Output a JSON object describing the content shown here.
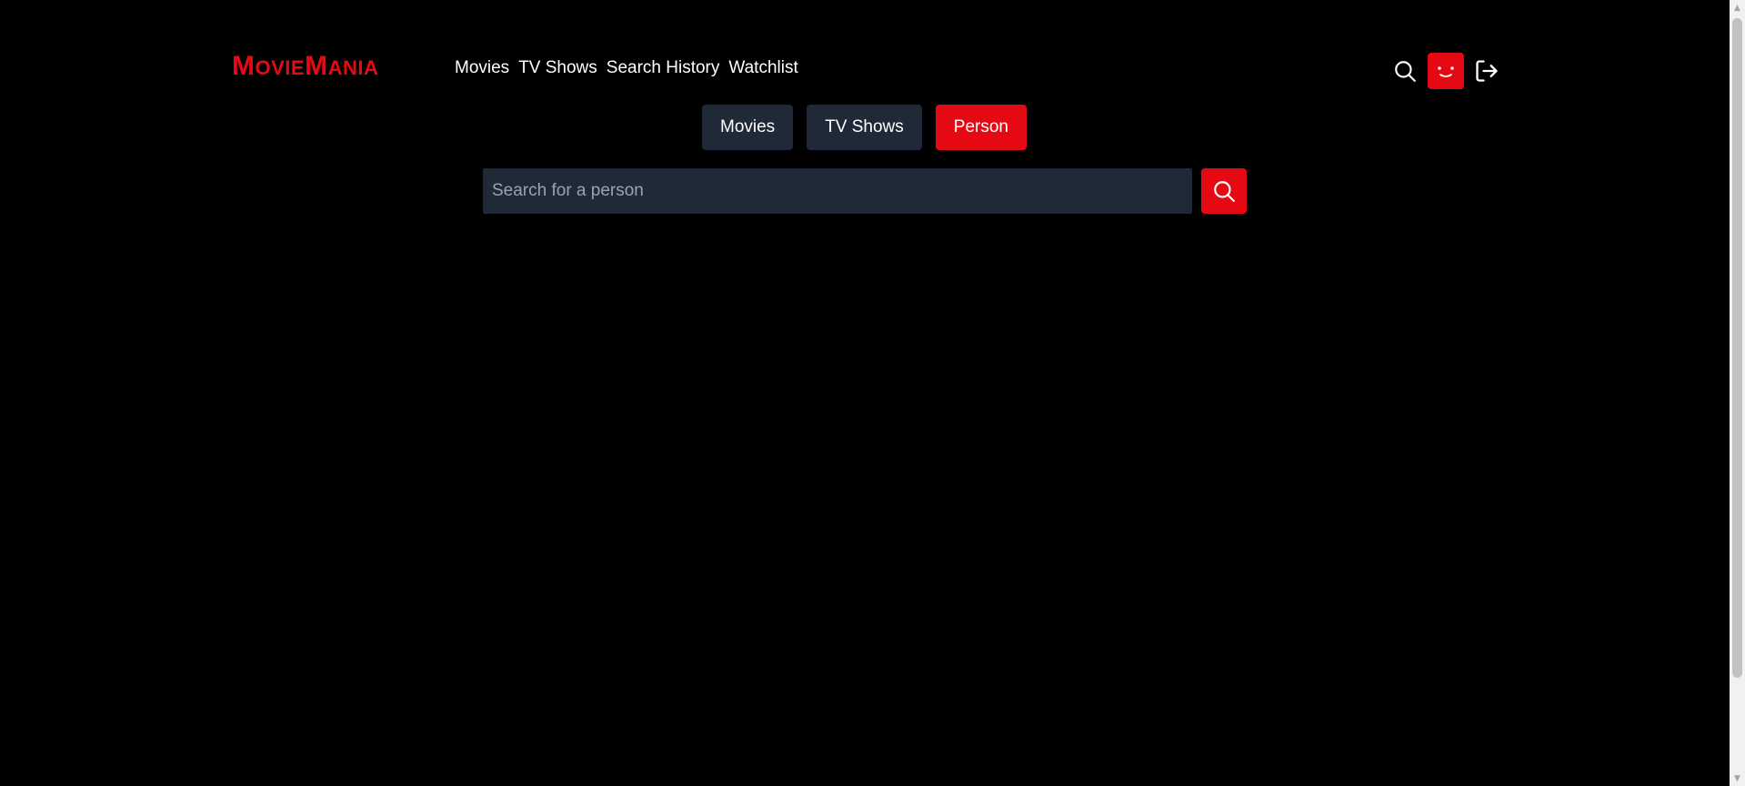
{
  "logo": {
    "first_big": "M",
    "first_rest": "ovie",
    "second_big": "M",
    "second_rest": "ania"
  },
  "nav": {
    "items": [
      {
        "label": "Movies"
      },
      {
        "label": "TV Shows"
      },
      {
        "label": "Search History"
      },
      {
        "label": "Watchlist"
      }
    ]
  },
  "header_icons": {
    "search": "search-icon",
    "avatar": "smiley-avatar",
    "logout": "logout-icon"
  },
  "tabs": [
    {
      "label": "Movies",
      "active": false
    },
    {
      "label": "TV Shows",
      "active": false
    },
    {
      "label": "Person",
      "active": true
    }
  ],
  "search": {
    "placeholder": "Search for a person",
    "value": ""
  },
  "colors": {
    "background": "#000000",
    "accent": "#e50914",
    "surface": "#1f2937",
    "placeholder": "#9ca3af"
  }
}
